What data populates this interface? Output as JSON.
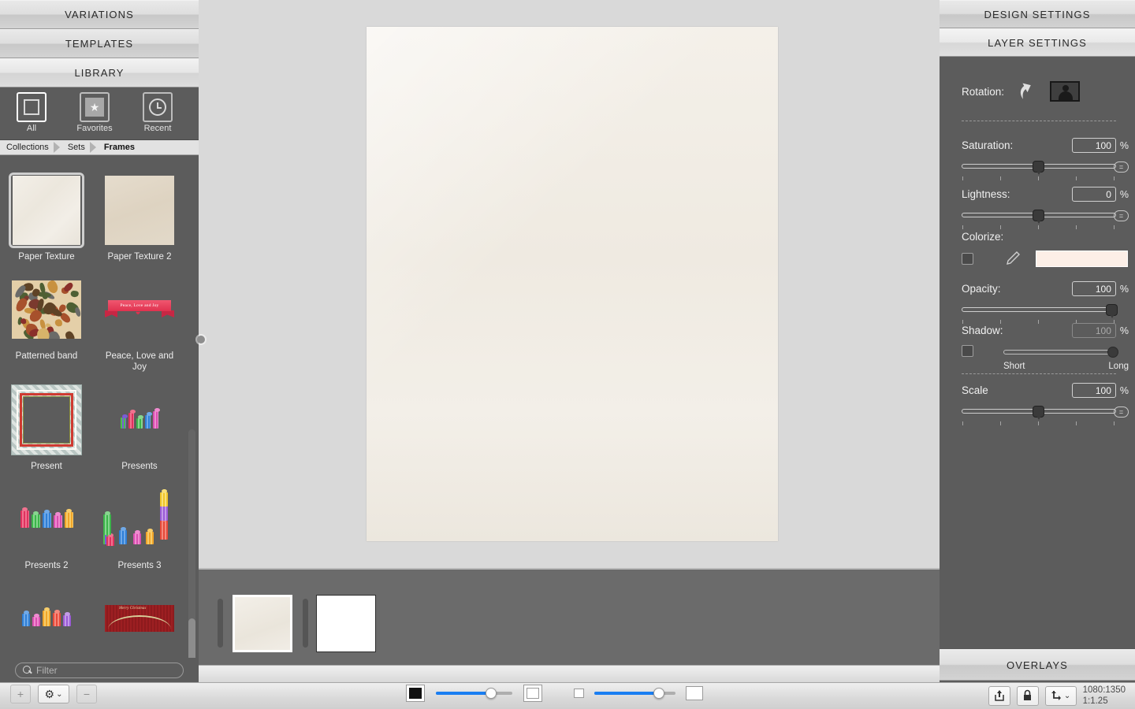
{
  "left_panel": {
    "accordion": [
      {
        "label": "VARIATIONS",
        "active": false
      },
      {
        "label": "TEMPLATES",
        "active": false
      },
      {
        "label": "LIBRARY",
        "active": true
      }
    ],
    "library_modes": [
      {
        "label": "All",
        "icon": "square-icon",
        "selected": true
      },
      {
        "label": "Favorites",
        "icon": "star-icon",
        "selected": false
      },
      {
        "label": "Recent",
        "icon": "clock-icon",
        "selected": false
      }
    ],
    "breadcrumb": [
      "Collections",
      "Sets",
      "Frames"
    ],
    "items": [
      {
        "label": "Paper Texture",
        "kind": "paper1",
        "selected": true
      },
      {
        "label": "Paper Texture 2",
        "kind": "paper2",
        "selected": false
      },
      {
        "label": "Patterned band",
        "kind": "patband",
        "selected": false
      },
      {
        "label": "Peace, Love and Joy",
        "kind": "banner",
        "banner_text": "Peace, Love and Joy",
        "selected": false
      },
      {
        "label": "Present",
        "kind": "frame",
        "selected": false
      },
      {
        "label": "Presents",
        "kind": "presents1",
        "selected": false
      },
      {
        "label": "Presents 2",
        "kind": "presents2",
        "selected": false
      },
      {
        "label": "Presents 3",
        "kind": "presents3",
        "selected": false
      },
      {
        "label": "",
        "kind": "presents4",
        "selected": false
      },
      {
        "label": "",
        "kind": "merry",
        "banner_text": "Merry Christmas",
        "selected": false
      }
    ],
    "filter": {
      "placeholder": "Filter",
      "value": "",
      "icon": "search-icon"
    },
    "toolbar": {
      "add_label": "+",
      "gear_label": "⚙",
      "gear_caret": "⌄",
      "remove_label": "−"
    }
  },
  "center": {
    "filmstrip_pages": [
      {
        "kind": "paper",
        "selected": true
      },
      {
        "kind": "white",
        "selected": false
      }
    ]
  },
  "right_panel": {
    "tabs": [
      {
        "label": "DESIGN SETTINGS",
        "active": false
      },
      {
        "label": "LAYER SETTINGS",
        "active": true
      }
    ],
    "rotation": {
      "label": "Rotation:",
      "rotate_icon": "rotate-arrow-icon",
      "orientation_icon": "portrait-landscape-icon"
    },
    "saturation": {
      "label": "Saturation:",
      "value": "100",
      "unit": "%",
      "knob_pct": 50
    },
    "lightness": {
      "label": "Lightness:",
      "value": "0",
      "unit": "%",
      "knob_pct": 50
    },
    "colorize": {
      "label": "Colorize:",
      "checked": false,
      "eyedropper_icon": "eyedropper-icon",
      "swatch_color": "#fcefe7"
    },
    "opacity": {
      "label": "Opacity:",
      "value": "100",
      "unit": "%",
      "knob_pct": 100
    },
    "shadow": {
      "label": "Shadow:",
      "value": "100",
      "unit": "%",
      "checked": false,
      "knob_pct": 100,
      "min_label": "Short",
      "max_label": "Long"
    },
    "scale": {
      "label": "Scale",
      "value": "100",
      "unit": "%",
      "knob_pct": 50
    },
    "overlays_tab": "OVERLAYS"
  },
  "bottom_bar": {
    "bg_slider": {
      "value_pct": 72,
      "left_icon": "black-square-icon",
      "right_icon": "white-square-icon"
    },
    "size_slider": {
      "value_pct": 80,
      "left_icon": "small-square-icon",
      "right_icon": "large-square-icon"
    },
    "share_icon": "share-upload-icon",
    "lock_icon": "lock-closed-icon",
    "transform_icon": "transform-axis-icon",
    "transform_caret": "⌄",
    "dimensions": "1080:1350",
    "ratio": "1:1.25"
  },
  "colors": {
    "panel_bg": "#5c5c5c",
    "canvas_bg": "#d9d9d9",
    "filmstrip_bg": "#6b6b6b",
    "accent_blue": "#1a7ef2",
    "paper": "#f2eee7"
  }
}
